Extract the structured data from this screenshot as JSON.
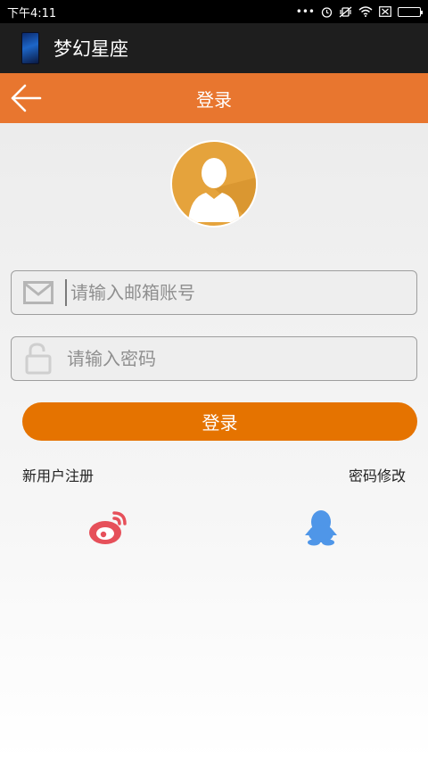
{
  "status_bar": {
    "time": "下午4:11",
    "more": "•••"
  },
  "app": {
    "title": "梦幻星座"
  },
  "header": {
    "title": "登录"
  },
  "form": {
    "email_placeholder": "请输入邮箱账号",
    "password_placeholder": "请输入密码",
    "login_label": "登录"
  },
  "links": {
    "register": "新用户注册",
    "change_password": "密码修改"
  },
  "colors": {
    "accent": "#e8762f",
    "button": "#e57300",
    "weibo": "#e6505a",
    "qq": "#4f96e8"
  }
}
